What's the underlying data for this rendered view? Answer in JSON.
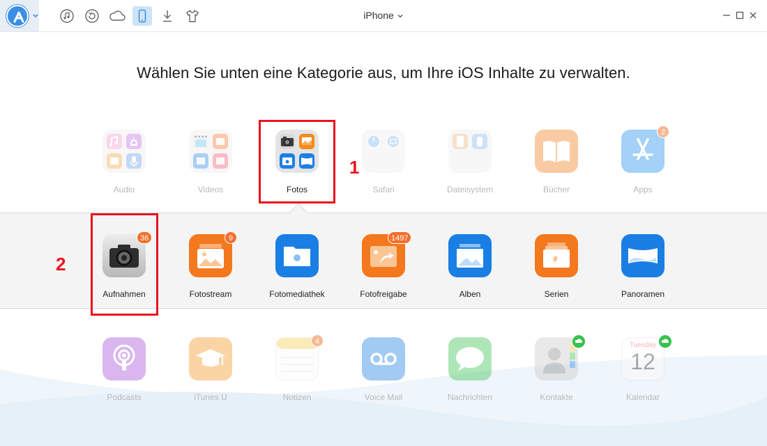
{
  "window": {
    "device_title": "iPhone",
    "accent": "#3a8ee6"
  },
  "toolbar": {
    "buttons": [
      {
        "icon": "music-icon"
      },
      {
        "icon": "restore-icon"
      },
      {
        "icon": "cloud-icon"
      },
      {
        "icon": "phone-icon",
        "active": true
      },
      {
        "icon": "download-icon"
      },
      {
        "icon": "tshirt-icon"
      }
    ]
  },
  "headline": "Wählen Sie unten eine Kategorie aus, um Ihre iOS Inhalte zu verwalten.",
  "categories": [
    {
      "label": "Audio"
    },
    {
      "label": "Videos"
    },
    {
      "label": "Fotos",
      "selected": true
    },
    {
      "label": "Safari"
    },
    {
      "label": "Dateisystem"
    },
    {
      "label": "Bücher"
    },
    {
      "label": "Apps",
      "badge": "2"
    }
  ],
  "photo_subcategories": [
    {
      "label": "Aufnahmen",
      "badge": "36"
    },
    {
      "label": "Fotostream",
      "badge": "9"
    },
    {
      "label": "Fotomediathek"
    },
    {
      "label": "Fotofreigabe",
      "badge": "1497"
    },
    {
      "label": "Alben"
    },
    {
      "label": "Serien"
    },
    {
      "label": "Panoramen"
    }
  ],
  "more_categories": [
    {
      "label": "Podcasts"
    },
    {
      "label": "iTunes U"
    },
    {
      "label": "Notizen",
      "badge": "4"
    },
    {
      "label": "Voice Mail"
    },
    {
      "label": "Nachrichten"
    },
    {
      "label": "Kontakte"
    },
    {
      "label": "Kalendar",
      "icon_day": "Tuesday",
      "icon_date": "12"
    }
  ],
  "annotations": {
    "step1": "1",
    "step2": "2",
    "highlight_color": "#e8141f"
  }
}
